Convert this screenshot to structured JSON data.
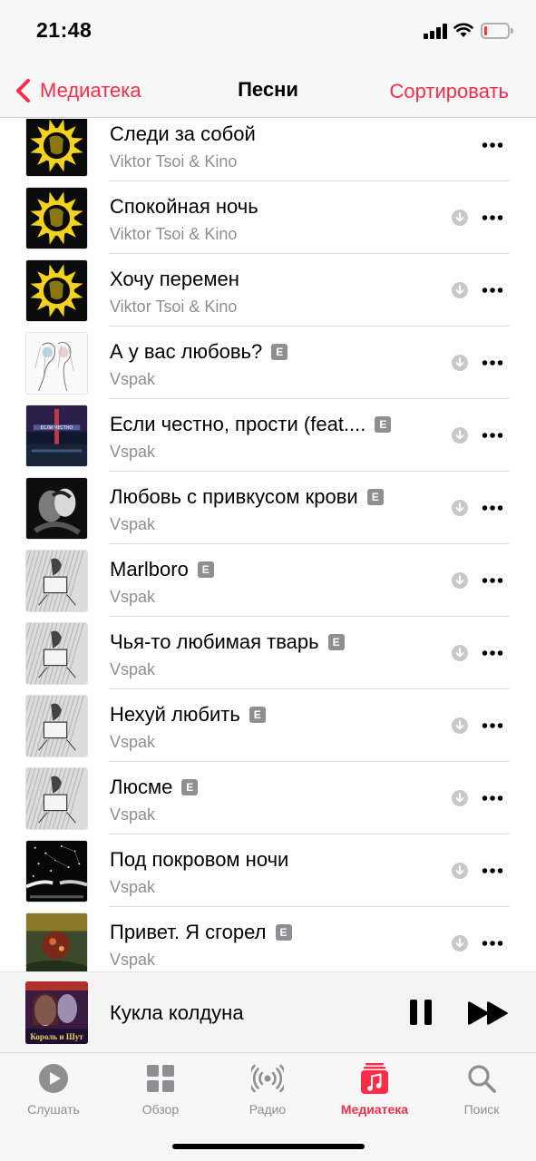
{
  "status_bar": {
    "time": "21:48"
  },
  "nav": {
    "back_label": "Медиатека",
    "title": "Песни",
    "sort_label": "Сортировать"
  },
  "songs": [
    {
      "title": "Следи за собой",
      "artist": "Viktor Tsoi & Kino",
      "explicit": false,
      "downloadable": false,
      "art": "kino-sun"
    },
    {
      "title": "Спокойная ночь",
      "artist": "Viktor Tsoi & Kino",
      "explicit": false,
      "downloadable": true,
      "art": "kino-sun"
    },
    {
      "title": "Хочу перемен",
      "artist": "Viktor Tsoi & Kino",
      "explicit": false,
      "downloadable": true,
      "art": "kino-sun"
    },
    {
      "title": "А у вас любовь?",
      "artist": "Vspak",
      "explicit": true,
      "downloadable": true,
      "art": "sketch-couple"
    },
    {
      "title": "Если честно, прости (feat....",
      "artist": "Vspak",
      "explicit": true,
      "downloadable": true,
      "art": "dark-city"
    },
    {
      "title": "Любовь с привкусом крови",
      "artist": "Vspak",
      "explicit": true,
      "downloadable": true,
      "art": "dark-couple"
    },
    {
      "title": "Marlboro",
      "artist": "Vspak",
      "explicit": true,
      "downloadable": true,
      "art": "grey-sketch"
    },
    {
      "title": "Чья-то любимая тварь",
      "artist": "Vspak",
      "explicit": true,
      "downloadable": true,
      "art": "grey-sketch"
    },
    {
      "title": "Нехуй любить",
      "artist": "Vspak",
      "explicit": true,
      "downloadable": true,
      "art": "grey-sketch"
    },
    {
      "title": "Люсме",
      "artist": "Vspak",
      "explicit": true,
      "downloadable": true,
      "art": "grey-sketch"
    },
    {
      "title": "Под покровом ночи",
      "artist": "Vspak",
      "explicit": false,
      "downloadable": true,
      "art": "night-stars"
    },
    {
      "title": "Привет. Я сгорел",
      "artist": "Vspak",
      "explicit": true,
      "downloadable": true,
      "art": "burnt"
    }
  ],
  "explicit_badge": "E",
  "now_playing": {
    "title": "Кукла колдуна",
    "cover_text": "Король и Шут"
  },
  "tabs": [
    {
      "label": "Слушать",
      "icon": "play-circle-icon",
      "active": false
    },
    {
      "label": "Обзор",
      "icon": "grid-icon",
      "active": false
    },
    {
      "label": "Радио",
      "icon": "radio-waves-icon",
      "active": false
    },
    {
      "label": "Медиатека",
      "icon": "music-library-icon",
      "active": true
    },
    {
      "label": "Поиск",
      "icon": "search-icon",
      "active": false
    }
  ],
  "colors": {
    "accent": "#fa2d48",
    "secondary_text": "#8e8e93",
    "separator": "#dcdcdc"
  }
}
